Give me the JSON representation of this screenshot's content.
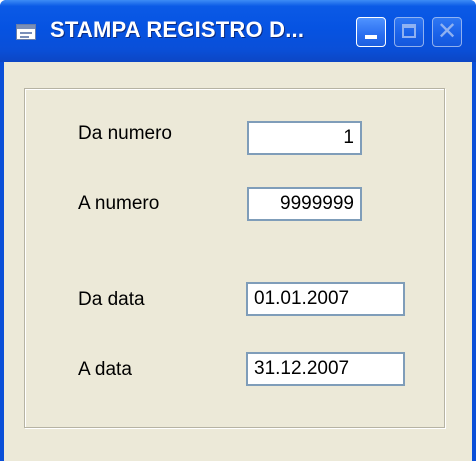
{
  "window": {
    "title": "STAMPA REGISTRO D...",
    "icon": "form-icon",
    "controls": {
      "minimize": "minimize-icon",
      "maximize": "maximize-icon",
      "close": "close-icon"
    }
  },
  "form": {
    "from_number": {
      "label": "Da numero",
      "value": "1"
    },
    "to_number": {
      "label": "A  numero",
      "value": "9999999"
    },
    "from_date": {
      "label": "Da data",
      "value": "01.01.2007"
    },
    "to_date": {
      "label": "A  data",
      "value": "31.12.2007"
    }
  },
  "colors": {
    "titlebar": "#0a4fd8",
    "client_background": "#ece9d8",
    "field_border": "#7f9db9"
  }
}
